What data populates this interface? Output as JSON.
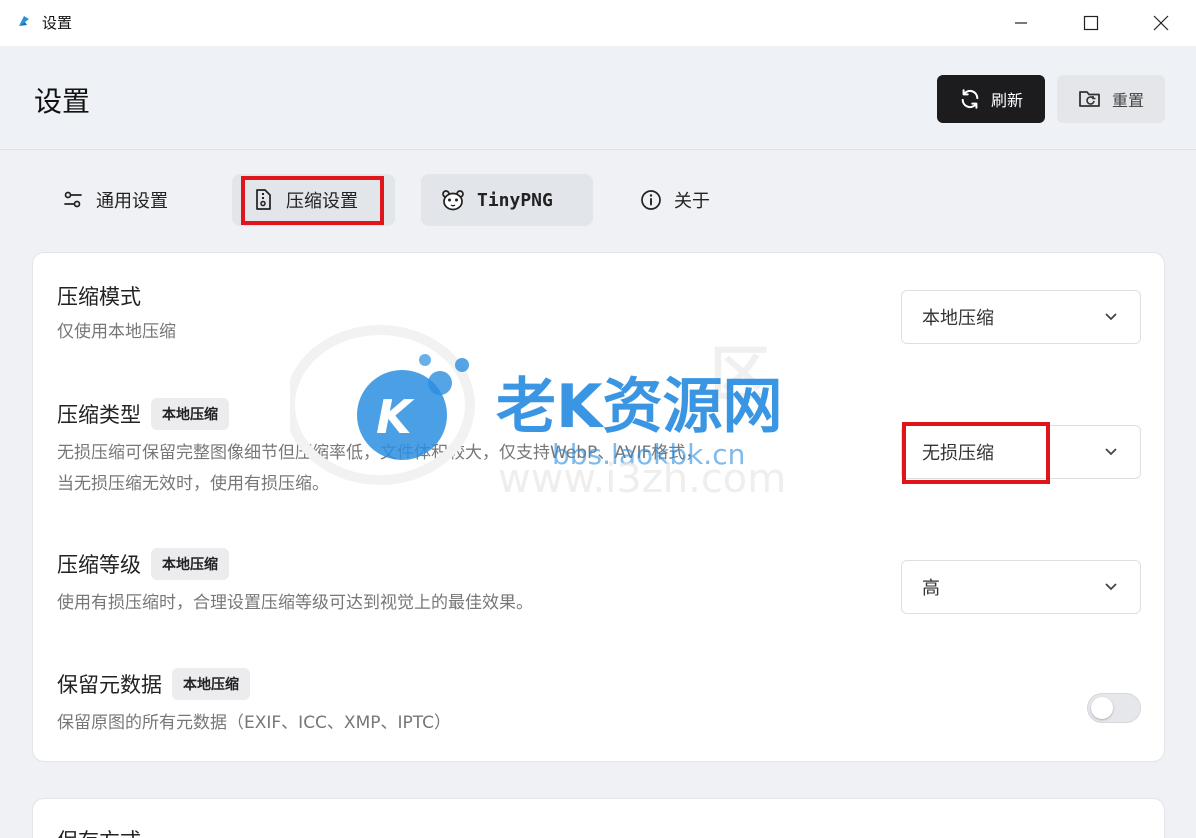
{
  "window": {
    "title": "设置",
    "controls": [
      "—",
      "☐",
      "✕"
    ]
  },
  "header": {
    "title": "设置",
    "refresh_label": "刷新",
    "reset_label": "重置"
  },
  "tabs": [
    {
      "label": "通用设置",
      "icon": "sliders-icon"
    },
    {
      "label": "压缩设置",
      "icon": "compress-file-icon",
      "active": true
    },
    {
      "label": "TinyPNG",
      "icon": "panda-icon"
    },
    {
      "label": "关于",
      "icon": "info-icon"
    }
  ],
  "settings": {
    "mode": {
      "title": "压缩模式",
      "desc": "仅使用本地压缩",
      "value": "本地压缩"
    },
    "type": {
      "title": "压缩类型",
      "badge": "本地压缩",
      "desc_line1": "无损压缩可保留完整图像细节但压缩率低，文件体积较大，仅支持WebP、AVIF格式，",
      "desc_line2": "当无损压缩无效时，使用有损压缩。",
      "value": "无损压缩"
    },
    "level": {
      "title": "压缩等级",
      "badge": "本地压缩",
      "desc": "使用有损压缩时，合理设置压缩等级可达到视觉上的最佳效果。",
      "value": "高"
    },
    "metadata": {
      "title": "保留元数据",
      "badge": "本地压缩",
      "desc": "保留原图的所有元数据（EXIF、ICC、XMP、IPTC）",
      "enabled": false
    }
  },
  "next_section": {
    "title": "保存方式"
  },
  "watermark": {
    "brand": "老K资源网",
    "url1": "bbs.laokbk.cn",
    "url2": "www.i3zh.com"
  },
  "colors": {
    "highlight": "#e0151b",
    "primary_button": "#1c1c1e",
    "watermark": "#2a8ee0"
  }
}
